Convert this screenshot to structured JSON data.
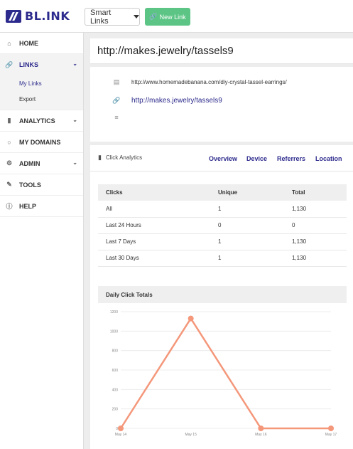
{
  "header": {
    "logo_text": "BL.INK",
    "smart_links_label": "Smart Links",
    "new_link_label": "New Link"
  },
  "sidebar": {
    "items": [
      {
        "label": "HOME",
        "icon": "home-icon"
      },
      {
        "label": "LINKS",
        "icon": "link-icon",
        "active": true
      },
      {
        "label": "ANALYTICS",
        "icon": "bar-chart-icon"
      },
      {
        "label": "MY DOMAINS",
        "icon": "lightbulb-icon"
      },
      {
        "label": "ADMIN",
        "icon": "gear-icon"
      },
      {
        "label": "TOOLS",
        "icon": "wrench-icon"
      },
      {
        "label": "HELP",
        "icon": "help-circle-icon"
      }
    ],
    "links_sub": [
      "My Links",
      "Export"
    ]
  },
  "link": {
    "title": "http://makes.jewelry/tassels9",
    "destination_url": "http://www.homemadebanana.com/diy-crystal-tassel-earrings/",
    "short_url": "http://makes.jewelry/tassels9"
  },
  "analytics": {
    "title": "Click Analytics",
    "tabs": [
      "Overview",
      "Device",
      "Referrers",
      "Location"
    ],
    "table": {
      "headers": [
        "Clicks",
        "Unique",
        "Total"
      ],
      "rows": [
        [
          "All",
          "1",
          "1,130"
        ],
        [
          "Last 24 Hours",
          "0",
          "0"
        ],
        [
          "Last 7 Days",
          "1",
          "1,130"
        ],
        [
          "Last 30 Days",
          "1",
          "1,130"
        ]
      ]
    },
    "chart_title": "Daily Click Totals"
  },
  "colors": {
    "brand": "#2c2a8c",
    "new_link_green": "#5cc585",
    "chart_line": "#f4977a"
  },
  "chart_data": {
    "type": "line",
    "title": "Daily Click Totals",
    "x": [
      "May 14",
      "May 15",
      "May 16",
      "May 17"
    ],
    "series": [
      {
        "values": [
          0,
          1130,
          0,
          0
        ]
      }
    ],
    "ylim": [
      0,
      1200
    ],
    "yticks": [
      0,
      200,
      400,
      600,
      800,
      1000,
      1200
    ],
    "grid": true
  }
}
